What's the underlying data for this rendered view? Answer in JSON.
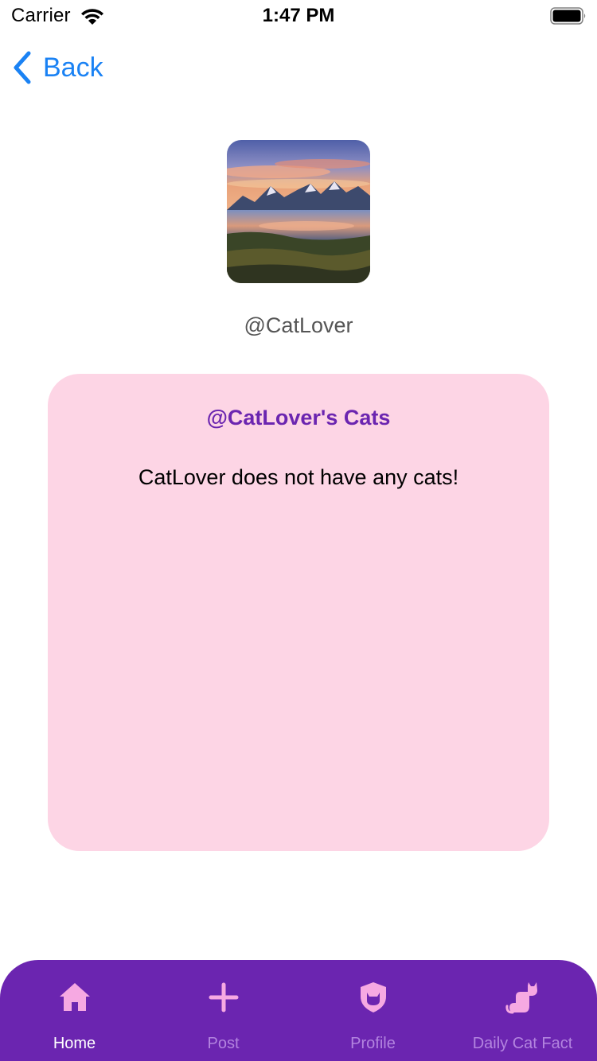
{
  "status_bar": {
    "carrier": "Carrier",
    "time": "1:47 PM"
  },
  "nav": {
    "back_label": "Back"
  },
  "profile": {
    "avatar_icon": "mountain-lake-photo",
    "username": "@CatLover"
  },
  "cats_section": {
    "title": "@CatLover's Cats",
    "empty_message": "CatLover does not have any cats!"
  },
  "tab_bar": {
    "items": [
      {
        "label": "Home",
        "icon": "home-icon",
        "active": true
      },
      {
        "label": "Post",
        "icon": "plus-icon",
        "active": false
      },
      {
        "label": "Profile",
        "icon": "shield-cat-icon",
        "active": false
      },
      {
        "label": "Daily Cat Fact",
        "icon": "cat-icon",
        "active": false
      }
    ]
  },
  "colors": {
    "accent_blue": "#1a82f4",
    "tab_bar_bg": "#6b25b0",
    "card_bg": "#fdd5e5",
    "card_title": "#6b25b0",
    "tab_icon": "#f6a9e2",
    "tab_label_active": "#ffffff",
    "tab_label_inactive": "#b384df"
  }
}
